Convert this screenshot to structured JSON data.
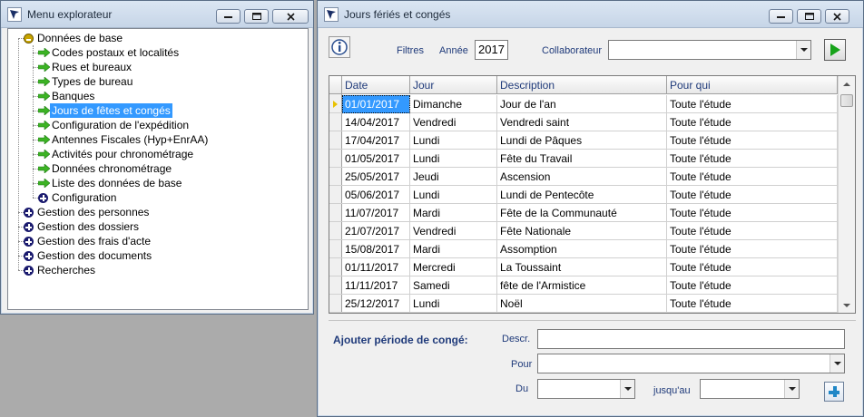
{
  "explorer": {
    "title": "Menu explorateur",
    "tree": [
      {
        "label": "Données de base",
        "level": 0,
        "expander": "minus"
      },
      {
        "label": "Codes postaux et localités",
        "level": 1,
        "icon": "arrow"
      },
      {
        "label": "Rues et bureaux",
        "level": 1,
        "icon": "arrow"
      },
      {
        "label": "Types de bureau",
        "level": 1,
        "icon": "arrow"
      },
      {
        "label": "Banques",
        "level": 1,
        "icon": "arrow"
      },
      {
        "label": "Jours de fêtes et congés",
        "level": 1,
        "icon": "arrow",
        "selected": true
      },
      {
        "label": "Configuration de l'expédition",
        "level": 1,
        "icon": "arrow"
      },
      {
        "label": "Antennes Fiscales (Hyp+EnrAA)",
        "level": 1,
        "icon": "arrow"
      },
      {
        "label": "Activités pour chronométrage",
        "level": 1,
        "icon": "arrow"
      },
      {
        "label": "Données chronométrage",
        "level": 1,
        "icon": "arrow"
      },
      {
        "label": "Liste des données de base",
        "level": 1,
        "icon": "arrow"
      },
      {
        "label": "Configuration",
        "level": 1,
        "expander": "plus"
      },
      {
        "label": "Gestion des personnes",
        "level": 0,
        "expander": "plus"
      },
      {
        "label": "Gestion des dossiers",
        "level": 0,
        "expander": "plus"
      },
      {
        "label": "Gestion des frais d'acte",
        "level": 0,
        "expander": "plus"
      },
      {
        "label": "Gestion des documents",
        "level": 0,
        "expander": "plus"
      },
      {
        "label": "Recherches",
        "level": 0,
        "expander": "plus"
      }
    ]
  },
  "conges": {
    "title": "Jours fériés et congés",
    "filters_label": "Filtres",
    "year_label": "Année",
    "year_value": "2017",
    "collab_label": "Collaborateur",
    "collab_value": "",
    "columns": [
      "Date",
      "Jour",
      "Description",
      "Pour qui"
    ],
    "rows": [
      [
        "01/01/2017",
        "Dimanche",
        "Jour de l'an",
        "Toute l'étude"
      ],
      [
        "14/04/2017",
        "Vendredi",
        "Vendredi saint",
        "Toute l'étude"
      ],
      [
        "17/04/2017",
        "Lundi",
        "Lundi de Pâques",
        "Toute l'étude"
      ],
      [
        "01/05/2017",
        "Lundi",
        "Fête du Travail",
        "Toute l'étude"
      ],
      [
        "25/05/2017",
        "Jeudi",
        "Ascension",
        "Toute l'étude"
      ],
      [
        "05/06/2017",
        "Lundi",
        "Lundi de Pentecôte",
        "Toute l'étude"
      ],
      [
        "11/07/2017",
        "Mardi",
        "Fête de la Communauté",
        "Toute l'étude"
      ],
      [
        "21/07/2017",
        "Vendredi",
        "Fête Nationale",
        "Toute l'étude"
      ],
      [
        "15/08/2017",
        "Mardi",
        "Assomption",
        "Toute l'étude"
      ],
      [
        "01/11/2017",
        "Mercredi",
        "La Toussaint",
        "Toute l'étude"
      ],
      [
        "11/11/2017",
        "Samedi",
        "fête de l'Armistice",
        "Toute l'étude"
      ],
      [
        "25/12/2017",
        "Lundi",
        "Noël",
        "Toute l'étude"
      ]
    ],
    "add_period_label": "Ajouter période de congé:",
    "descr_label": "Descr.",
    "descr_value": "",
    "pour_label": "Pour",
    "pour_value": "",
    "du_label": "Du",
    "du_value": "",
    "jusquau_label": "jusqu'au",
    "jusquau_value": ""
  },
  "colors": {
    "selection": "#3399ff",
    "label_blue": "#1f3a7a",
    "run_green": "#17a31a",
    "add_blue": "#1f87c7"
  }
}
